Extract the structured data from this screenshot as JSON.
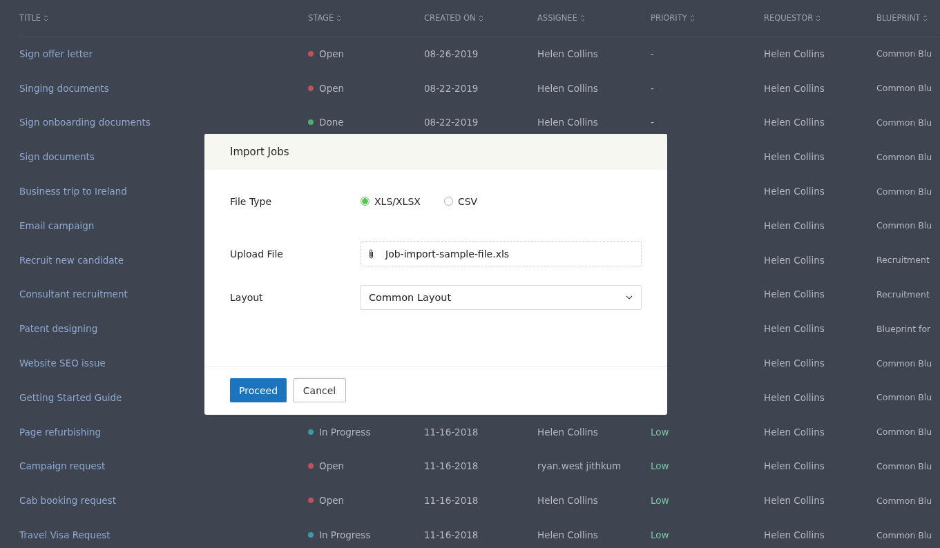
{
  "table": {
    "columns": [
      "TITLE",
      "STAGE",
      "CREATED ON",
      "ASSIGNEE",
      "PRIORITY",
      "REQUESTOR",
      "BLUEPRINT"
    ],
    "rows": [
      {
        "title": "Sign offer letter",
        "stage": {
          "label": "Open",
          "color": "#c0505a"
        },
        "created": "08-26-2019",
        "assignee": "Helen Collins",
        "priority": {
          "label": "-",
          "color": "#b3b8c0"
        },
        "requestor": "Helen Collins",
        "blueprint": "Common Blu"
      },
      {
        "title": "Singing documents",
        "stage": {
          "label": "Open",
          "color": "#c0505a"
        },
        "created": "08-22-2019",
        "assignee": "Helen Collins",
        "priority": {
          "label": "-",
          "color": "#b3b8c0"
        },
        "requestor": "Helen Collins",
        "blueprint": "Common Blu"
      },
      {
        "title": "Sign onboarding documents",
        "stage": {
          "label": "Done",
          "color": "#4caf6a"
        },
        "created": "08-22-2019",
        "assignee": "Helen Collins",
        "priority": {
          "label": "-",
          "color": "#b3b8c0"
        },
        "requestor": "Helen Collins",
        "blueprint": "Common Blu"
      },
      {
        "title": "Sign documents",
        "requestor": "Helen Collins",
        "blueprint": "Common Blu"
      },
      {
        "title": "Business trip to Ireland",
        "requestor": "Helen Collins",
        "blueprint": "Common Blu"
      },
      {
        "title": "Email campaign",
        "requestor": "Helen Collins",
        "blueprint": "Common Blu"
      },
      {
        "title": "Recruit new candidate",
        "requestor": "Helen Collins",
        "blueprint": "Recruitment"
      },
      {
        "title": "Consultant recruitment",
        "requestor": "Helen Collins",
        "blueprint": "Recruitment"
      },
      {
        "title": "Patent designing",
        "requestor": "Helen Collins",
        "blueprint": "Blueprint for"
      },
      {
        "title": "Website SEO issue",
        "requestor": "Helen Collins",
        "blueprint": "Common Blu"
      },
      {
        "title": "Getting Started Guide",
        "requestor": "Helen Collins",
        "blueprint": "Common Blu"
      },
      {
        "title": "Page refurbishing",
        "stage": {
          "label": "In Progress",
          "color": "#3a9aa8"
        },
        "created": "11-16-2018",
        "assignee": "Helen Collins",
        "priority": {
          "label": "Low",
          "color": "#7cc4a2"
        },
        "requestor": "Helen Collins",
        "blueprint": "Common Blu"
      },
      {
        "title": "Campaign request",
        "stage": {
          "label": "Open",
          "color": "#c0505a"
        },
        "created": "11-16-2018",
        "assignee": "ryan.west jithkum",
        "priority": {
          "label": "Low",
          "color": "#7cc4a2"
        },
        "requestor": "Helen Collins",
        "blueprint": "Common Blu"
      },
      {
        "title": "Cab booking request",
        "stage": {
          "label": "Open",
          "color": "#c0505a"
        },
        "created": "11-16-2018",
        "assignee": "Helen Collins",
        "priority": {
          "label": "Low",
          "color": "#7cc4a2"
        },
        "requestor": "Helen Collins",
        "blueprint": "Common Blu"
      },
      {
        "title": "Travel Visa Request",
        "stage": {
          "label": "In Progress",
          "color": "#3a9aa8"
        },
        "created": "11-16-2018",
        "assignee": "Helen Collins",
        "priority": {
          "label": "Low",
          "color": "#7cc4a2"
        },
        "requestor": "Helen Collins",
        "blueprint": "Common Blu"
      }
    ]
  },
  "dialog": {
    "title": "Import Jobs",
    "fields": [
      {
        "kind": "radio",
        "label": "File Type",
        "options": [
          {
            "label": "XLS/XLSX",
            "selected": true
          },
          {
            "label": "CSV",
            "selected": false
          }
        ]
      },
      {
        "kind": "file",
        "label": "Upload File",
        "value": "Job-import-sample-file.xls"
      },
      {
        "kind": "select",
        "label": "Layout",
        "value": "Common Layout"
      }
    ],
    "buttons": [
      {
        "label": "Proceed",
        "kind": "primary"
      },
      {
        "label": "Cancel",
        "kind": "secondary"
      }
    ]
  }
}
